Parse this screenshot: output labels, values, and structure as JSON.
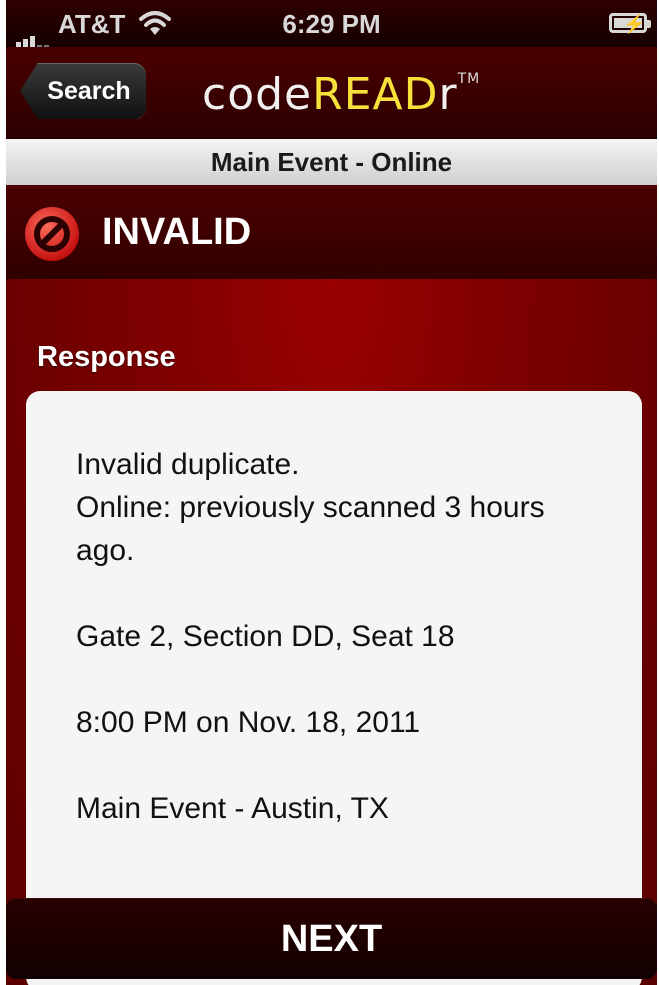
{
  "status_bar": {
    "carrier": "AT&T",
    "time": "6:29 PM",
    "signal_icon": "signal-bars-icon",
    "wifi_icon": "wifi-icon",
    "battery_icon": "battery-charging-icon"
  },
  "navbar": {
    "back_label": "Search",
    "logo_part1": "code",
    "logo_part2": "READ",
    "logo_part3": "r",
    "logo_tm": "TM"
  },
  "subtitle": "Main Event - Online",
  "result": {
    "icon": "no-entry-icon",
    "title": "INVALID"
  },
  "response": {
    "label": "Response",
    "line1": "Invalid duplicate.",
    "line2": "Online: previously scanned 3 hours ago.",
    "seat": "Gate 2, Section DD, Seat 18",
    "datetime": "8:00 PM on Nov. 18, 2011",
    "event": "Main Event - Austin, TX"
  },
  "next_label": "NEXT",
  "colors": {
    "background": "#7a0000",
    "logo_accent": "#f7e23a",
    "invalid_icon": "#e02020"
  }
}
